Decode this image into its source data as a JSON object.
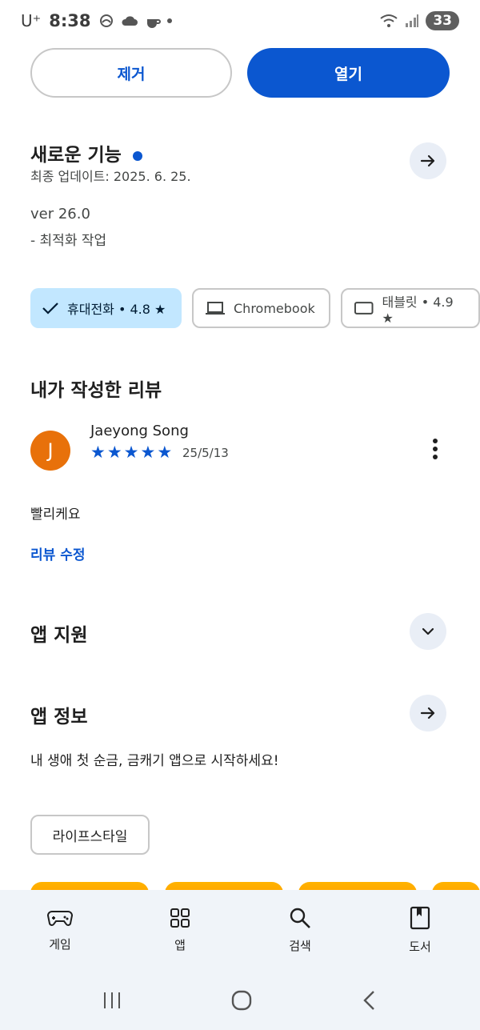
{
  "status_bar": {
    "carrier": "U⁺",
    "time": "8:38",
    "battery": "33"
  },
  "actions": {
    "remove_label": "제거",
    "open_label": "열기"
  },
  "whats_new": {
    "title": "새로운 기능",
    "updated": "최종 업데이트: 2025. 6. 25.",
    "version": "ver 26.0",
    "note": "- 최적화 작업"
  },
  "device_chips": [
    {
      "label": "휴대전화 • 4.8 ★",
      "selected": true
    },
    {
      "label": "Chromebook",
      "selected": false
    },
    {
      "label": "태블릿 • 4.9 ★",
      "selected": false
    }
  ],
  "my_review": {
    "title": "내가 작성한 리뷰",
    "author": "Jaeyong Song",
    "avatar_initial": "J",
    "rating": 5,
    "date": "25/5/13",
    "text": "빨리케요",
    "edit_label": "리뷰 수정"
  },
  "app_support": {
    "title": "앱 지원"
  },
  "app_info": {
    "title": "앱 정보",
    "description": "내 생애 첫 순금, 금캐기 앱으로 시작하세요!",
    "category": "라이프스타일"
  },
  "bottom_nav": [
    {
      "label": "게임",
      "icon": "gamepad-icon"
    },
    {
      "label": "앱",
      "icon": "apps-grid-icon"
    },
    {
      "label": "검색",
      "icon": "search-icon"
    },
    {
      "label": "도서",
      "icon": "book-icon"
    }
  ],
  "colors": {
    "accent": "#0b57d0",
    "chip_selected": "#c2e7ff",
    "avatar": "#e8710a",
    "nav_bg": "#f0f4f9"
  }
}
